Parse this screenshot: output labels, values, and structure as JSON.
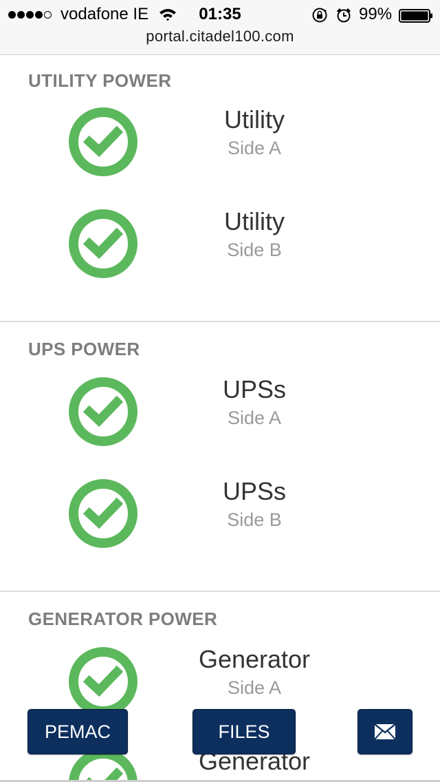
{
  "status_bar": {
    "carrier": "vodafone IE",
    "time": "01:35",
    "battery_percent": "99%",
    "signal_bars_filled": 4,
    "signal_bars_total": 5,
    "icons": [
      "signal-dots-icon",
      "wifi-icon",
      "rotation-lock-icon",
      "alarm-clock-icon",
      "battery-icon"
    ]
  },
  "browser": {
    "address": "portal.citadel100.com"
  },
  "colors": {
    "ok_green": "#5cb85c",
    "button_navy": "#0d2f5e",
    "section_title_gray": "#7d7d7d"
  },
  "sections": [
    {
      "title": "UTILITY POWER",
      "items": [
        {
          "name": "Utility",
          "side": "Side A",
          "status": "ok",
          "icon": "check-circle-icon"
        },
        {
          "name": "Utility",
          "side": "Side B",
          "status": "ok",
          "icon": "check-circle-icon"
        }
      ]
    },
    {
      "title": "UPS POWER",
      "items": [
        {
          "name": "UPSs",
          "side": "Side A",
          "status": "ok",
          "icon": "check-circle-icon"
        },
        {
          "name": "UPSs",
          "side": "Side B",
          "status": "ok",
          "icon": "check-circle-icon"
        }
      ]
    },
    {
      "title": "GENERATOR POWER",
      "items": [
        {
          "name": "Generator",
          "side": "Side A",
          "status": "ok",
          "icon": "check-circle-icon"
        },
        {
          "name": "Generator",
          "side": "",
          "status": "ok",
          "icon": "check-circle-icon"
        }
      ]
    }
  ],
  "footer_buttons": {
    "pemac_label": "PEMAC",
    "files_label": "FILES",
    "mail_icon": "envelope-icon"
  }
}
